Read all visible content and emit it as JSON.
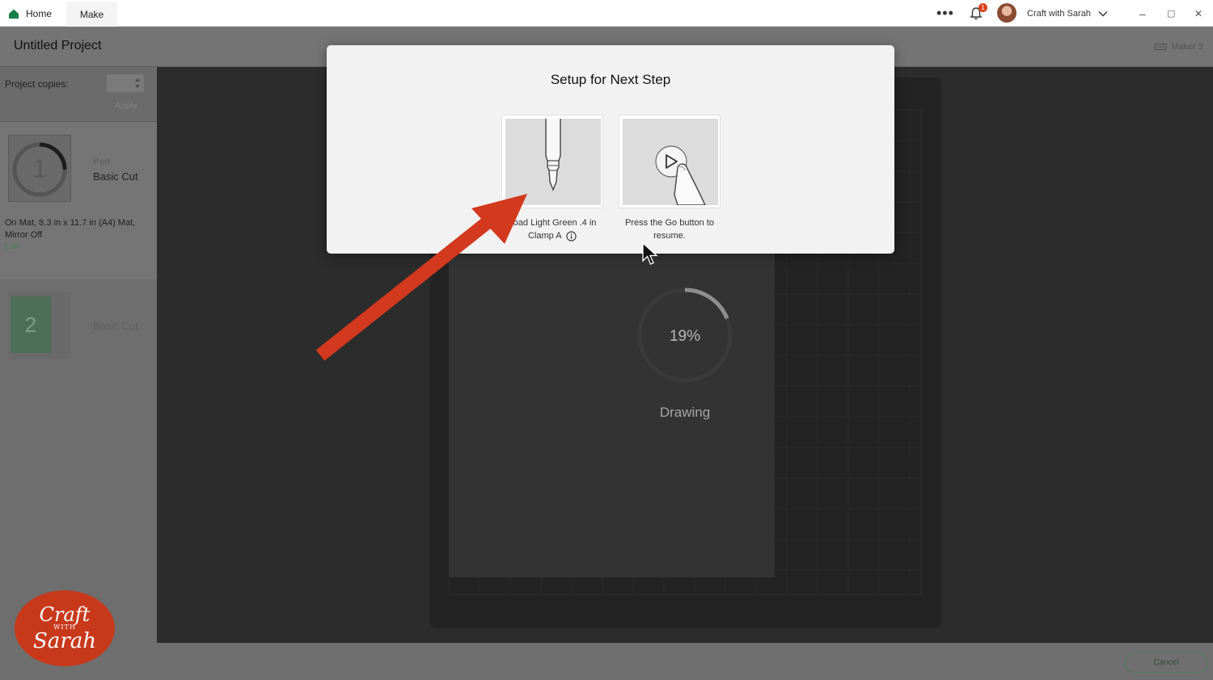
{
  "titlebar": {
    "home_tab": "Home",
    "make_tab": "Make",
    "more": "•••",
    "notification_count": "1",
    "user_name": "Craft with Sarah",
    "minimize": "–",
    "restore": "▢",
    "close": "✕",
    "accent_color": "#1a7f4b"
  },
  "header": {
    "project_title": "Untitled Project",
    "machine": "Maker 3"
  },
  "left_panel": {
    "copies_label": "Project copies:",
    "apply_label": "Apply",
    "mats": [
      {
        "number": "1",
        "tool": "Pen",
        "cut": "Basic Cut",
        "info": "On Mat, 8.3 in x 11.7 in (A4) Mat, Mirror Off",
        "edit": "Edit"
      },
      {
        "number": "2",
        "cut": "Basic Cut",
        "color": "#4d6e57"
      }
    ]
  },
  "progress": {
    "percent_label": "19%",
    "percent": 19,
    "status": "Drawing"
  },
  "modal": {
    "title": "Setup for Next Step",
    "step1_caption_1": "Load Light Green .4 in",
    "step1_caption_2": "Clamp A",
    "step2_caption_1": "Press the Go button to",
    "step2_caption_2": "resume."
  },
  "footer": {
    "cancel_label": "Cancel"
  },
  "watermark": {
    "line1": "Craft",
    "with": "WITH",
    "line2": "Sarah",
    "color": "#c8391c"
  }
}
